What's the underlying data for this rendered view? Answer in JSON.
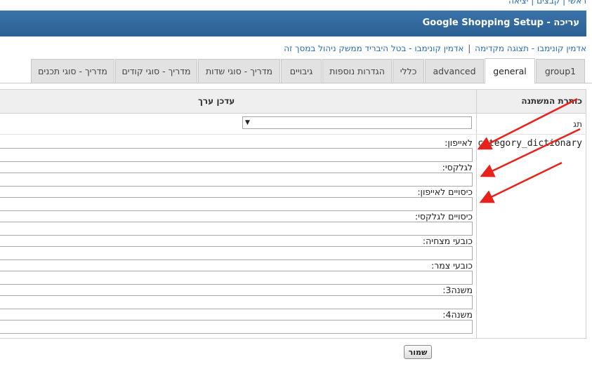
{
  "top_links": {
    "text": "ראשי | קבצים | יציאה"
  },
  "title_bar": {
    "title": "Google Shopping Setup - עריכה"
  },
  "breadcrumbs": {
    "item1": "אדמין קונימבו - תצוגה מקדימה",
    "separator": "|",
    "item2": "אדמין קונימבו - בטל היבריד ממשק ניהול במסך זה"
  },
  "tabs": [
    {
      "label": "group1"
    },
    {
      "label": "general"
    },
    {
      "label": "advanced"
    },
    {
      "label": "כללי"
    },
    {
      "label": "הגדרות נוספות"
    },
    {
      "label": "גיבויים"
    },
    {
      "label": "מדריך - סוגי שדות"
    },
    {
      "label": "מדריך - סוגי קודים"
    },
    {
      "label": "מדריך - סוגי תכנים"
    }
  ],
  "table": {
    "header_variable": "כותרת המשתנה",
    "header_editor": "עדכן ערך",
    "tag_label": "תג",
    "tag_select_value": "",
    "variable_name": "category_dictionary",
    "fields": [
      {
        "label": "לאייפון:",
        "value": ""
      },
      {
        "label": "לגלקסי:",
        "value": ""
      },
      {
        "label": "כיסויים לאייפון:",
        "value": ""
      },
      {
        "label": "כיסויים לגלקסי:",
        "value": ""
      },
      {
        "label": "כובעי מצחיה:",
        "value": ""
      },
      {
        "label": "כובעי צמר:",
        "value": ""
      },
      {
        "label": "משנה3:",
        "value": ""
      },
      {
        "label": "משנה4:",
        "value": ""
      }
    ]
  },
  "save_button": {
    "label": "שמור"
  },
  "colors": {
    "title_bar": "#2f6699",
    "link": "#2a6db0",
    "arrow": "#e8221b"
  }
}
